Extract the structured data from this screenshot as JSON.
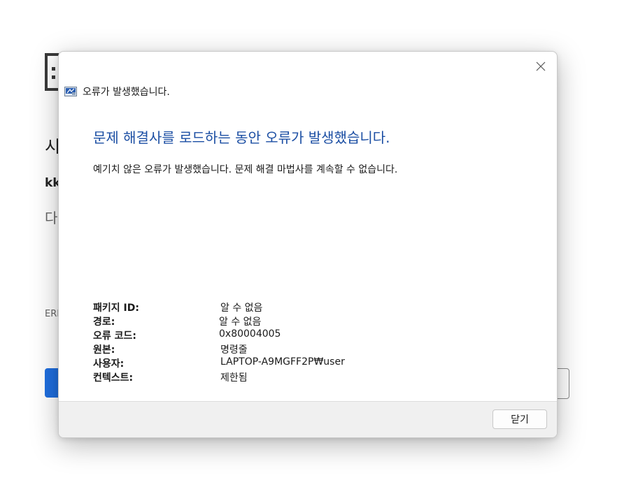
{
  "background_window": {
    "title_fragment": "시",
    "user_fragment": "kk",
    "desc_fragment": "다",
    "error_fragment": "ERI"
  },
  "dialog": {
    "caption": "오류가 발생했습니다.",
    "headline": "문제 해결사를 로드하는 동안 오류가 발생했습니다.",
    "message": "예기치 않은 오류가 발생했습니다. 문제 해결 마법사를 계속할 수 없습니다.",
    "details": [
      {
        "label": "패키지 ID:",
        "value": "알 수 없음"
      },
      {
        "label": "경로:",
        "value": "알 수 없음"
      },
      {
        "label": "오류 코드:",
        "value": "0x80004005"
      },
      {
        "label": "원본:",
        "value": "명령줄"
      },
      {
        "label": "사용자:",
        "value": "LAPTOP-A9MGFF2P₩user"
      },
      {
        "label": "컨텍스트:",
        "value": "제한됨"
      }
    ],
    "close_button_label": "닫기",
    "icons": {
      "close": "close-icon",
      "app": "troubleshooter-icon"
    }
  },
  "colors": {
    "headline": "#1b4ea3",
    "primary_button": "#1f6fe0",
    "footer_bg": "#f0f0f0"
  }
}
